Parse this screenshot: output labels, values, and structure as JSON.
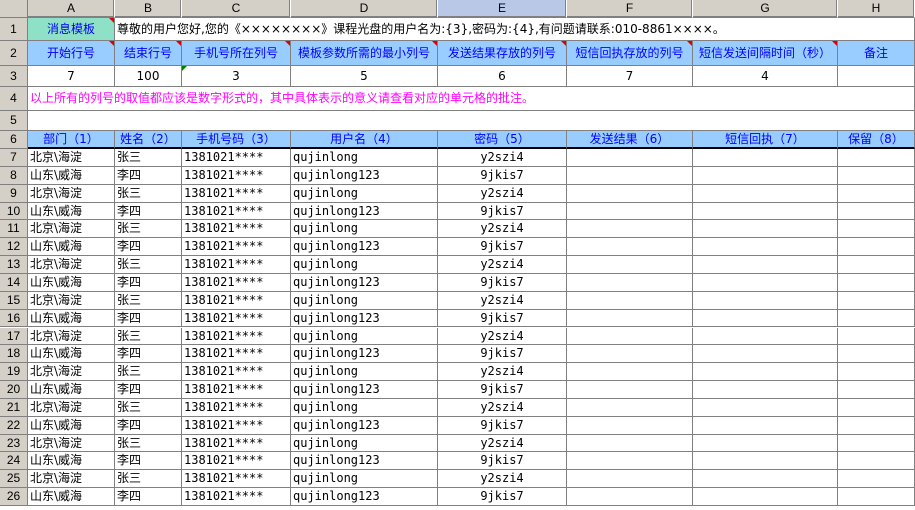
{
  "columns": [
    "A",
    "B",
    "C",
    "D",
    "E",
    "F",
    "G",
    "H"
  ],
  "selected_column": "E",
  "rows": [
    "1",
    "2",
    "3",
    "4",
    "5",
    "6",
    "7",
    "8",
    "9",
    "10",
    "11",
    "12",
    "13",
    "14",
    "15",
    "16",
    "17",
    "18",
    "19",
    "20",
    "21",
    "22",
    "23",
    "24",
    "25",
    "26"
  ],
  "row1": {
    "a": "消息模板",
    "bh": "尊敬的用户您好,您的《××××××××》课程光盘的用户名为:{3},密码为:{4},有问题请联系:010-8861××××。"
  },
  "row2": [
    "开始行号",
    "结束行号",
    "手机号所在列号",
    "模板参数所需的最小列号",
    "发送结果存放的列号",
    "短信回执存放的列号",
    "短信发送间隔时间（秒）",
    "备注"
  ],
  "row3": [
    "7",
    "100",
    "3",
    "5",
    "6",
    "7",
    "4",
    ""
  ],
  "row4": "以上所有的列号的取值都应该是数字形式的，其中具体表示的意义请查看对应的单元格的批注。",
  "row6": [
    "部门（1）",
    "姓名（2）",
    "手机号码（3）",
    "用户名（4）",
    "密码（5）",
    "发送结果（6）",
    "短信回执（7）",
    "保留（8）"
  ],
  "data": [
    [
      "北京\\海淀",
      "张三",
      "1381021****",
      "qujinlong",
      "y2szi4"
    ],
    [
      "山东\\威海",
      "李四",
      "1381021****",
      "qujinlong123",
      "9jkis7"
    ],
    [
      "北京\\海淀",
      "张三",
      "1381021****",
      "qujinlong",
      "y2szi4"
    ],
    [
      "山东\\威海",
      "李四",
      "1381021****",
      "qujinlong123",
      "9jkis7"
    ],
    [
      "北京\\海淀",
      "张三",
      "1381021****",
      "qujinlong",
      "y2szi4"
    ],
    [
      "山东\\威海",
      "李四",
      "1381021****",
      "qujinlong123",
      "9jkis7"
    ],
    [
      "北京\\海淀",
      "张三",
      "1381021****",
      "qujinlong",
      "y2szi4"
    ],
    [
      "山东\\威海",
      "李四",
      "1381021****",
      "qujinlong123",
      "9jkis7"
    ],
    [
      "北京\\海淀",
      "张三",
      "1381021****",
      "qujinlong",
      "y2szi4"
    ],
    [
      "山东\\威海",
      "李四",
      "1381021****",
      "qujinlong123",
      "9jkis7"
    ],
    [
      "北京\\海淀",
      "张三",
      "1381021****",
      "qujinlong",
      "y2szi4"
    ],
    [
      "山东\\威海",
      "李四",
      "1381021****",
      "qujinlong123",
      "9jkis7"
    ],
    [
      "北京\\海淀",
      "张三",
      "1381021****",
      "qujinlong",
      "y2szi4"
    ],
    [
      "山东\\威海",
      "李四",
      "1381021****",
      "qujinlong123",
      "9jkis7"
    ],
    [
      "北京\\海淀",
      "张三",
      "1381021****",
      "qujinlong",
      "y2szi4"
    ],
    [
      "山东\\威海",
      "李四",
      "1381021****",
      "qujinlong123",
      "9jkis7"
    ],
    [
      "北京\\海淀",
      "张三",
      "1381021****",
      "qujinlong",
      "y2szi4"
    ],
    [
      "山东\\威海",
      "李四",
      "1381021****",
      "qujinlong123",
      "9jkis7"
    ],
    [
      "北京\\海淀",
      "张三",
      "1381021****",
      "qujinlong",
      "y2szi4"
    ],
    [
      "山东\\威海",
      "李四",
      "1381021****",
      "qujinlong123",
      "9jkis7"
    ]
  ],
  "colors": {
    "header_blue": "#99ccff",
    "template_green": "#8ee0c6",
    "note_magenta": "#ff00ff",
    "header_text": "#0000ff"
  }
}
